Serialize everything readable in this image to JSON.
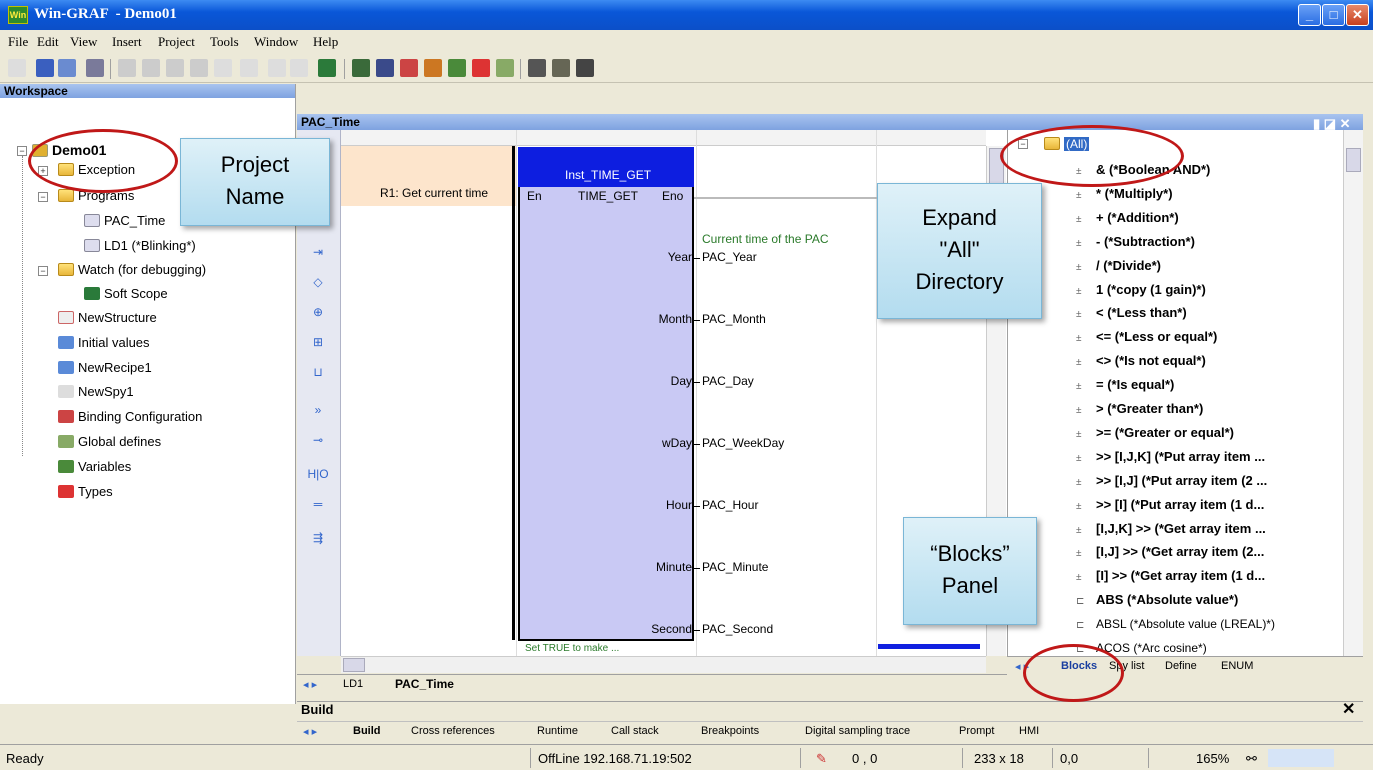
{
  "window": {
    "title": "Win-GRAF  - Demo01",
    "app_icon": "Win"
  },
  "menu": [
    "File",
    "Edit",
    "View",
    "Insert",
    "Project",
    "Tools",
    "Window",
    "Help"
  ],
  "workspace": {
    "header": "Workspace",
    "project": "Demo01",
    "items": [
      "Exception",
      "Programs",
      "PAC_Time",
      "LD1 (*Blinking*)",
      "Watch (for debugging)",
      "Soft Scope",
      "NewStructure",
      "Initial values",
      "NewRecipe1",
      "NewSpy1",
      "Binding Configuration",
      "Global defines",
      "Variables",
      "Types"
    ]
  },
  "editor": {
    "header": "PAC_Time",
    "rung_label": "R1: Get current time",
    "block_instance": "Inst_TIME_GET",
    "block_type": "TIME_GET",
    "pin_en": "En",
    "pin_eno": "Eno",
    "comment": "Current time of the PAC",
    "outputs": [
      {
        "pin": "Year",
        "var": "PAC_Year"
      },
      {
        "pin": "Month",
        "var": "PAC_Month"
      },
      {
        "pin": "Day",
        "var": "PAC_Day"
      },
      {
        "pin": "wDay",
        "var": "PAC_WeekDay"
      },
      {
        "pin": "Hour",
        "var": "PAC_Hour"
      },
      {
        "pin": "Minute",
        "var": "PAC_Minute"
      },
      {
        "pin": "Second",
        "var": "PAC_Second"
      }
    ],
    "tabs": [
      "LD1",
      "PAC_Time"
    ],
    "bottom_text": "Set TRUE to make ..."
  },
  "blocks": {
    "root": "(All)",
    "items": [
      "& (*Boolean AND*)",
      "* (*Multiply*)",
      "+ (*Addition*)",
      "- (*Subtraction*)",
      "/ (*Divide*)",
      "1 (*copy (1 gain)*)",
      "< (*Less than*)",
      "<= (*Less or equal*)",
      "<> (*Is not equal*)",
      "= (*Is equal*)",
      "> (*Greater than*)",
      ">= (*Greater or equal*)",
      ">> [I,J,K] (*Put array item ...",
      ">> [I,J] (*Put array item (2 ...",
      ">> [I] (*Put array item (1 d...",
      "[I,J,K] >> (*Get array item ...",
      "[I,J] >> (*Get array item (2...",
      "[I] >> (*Get array item (1 d...",
      "ABS (*Absolute value*)",
      "ABSL (*Absolute value (LREAL)*)",
      "ACOS (*Arc cosine*)"
    ],
    "tabs": [
      "Blocks",
      "Spy list",
      "Define",
      "ENUM"
    ]
  },
  "build": {
    "header": "Build",
    "tabs": [
      "Build",
      "Cross references",
      "Runtime",
      "Call stack",
      "Breakpoints",
      "Digital sampling trace",
      "Prompt",
      "HMI"
    ]
  },
  "status": {
    "ready": "Ready",
    "connection": "OffLine 192.168.71.19:502",
    "pos": "0 , 0",
    "size": "233 x 18",
    "coord": "0,0",
    "zoom": "165%"
  },
  "callouts": {
    "project": "Project\nName",
    "expand": "Expand\n\"All\"\nDirectory",
    "blocks": "“Blocks”\nPanel"
  }
}
